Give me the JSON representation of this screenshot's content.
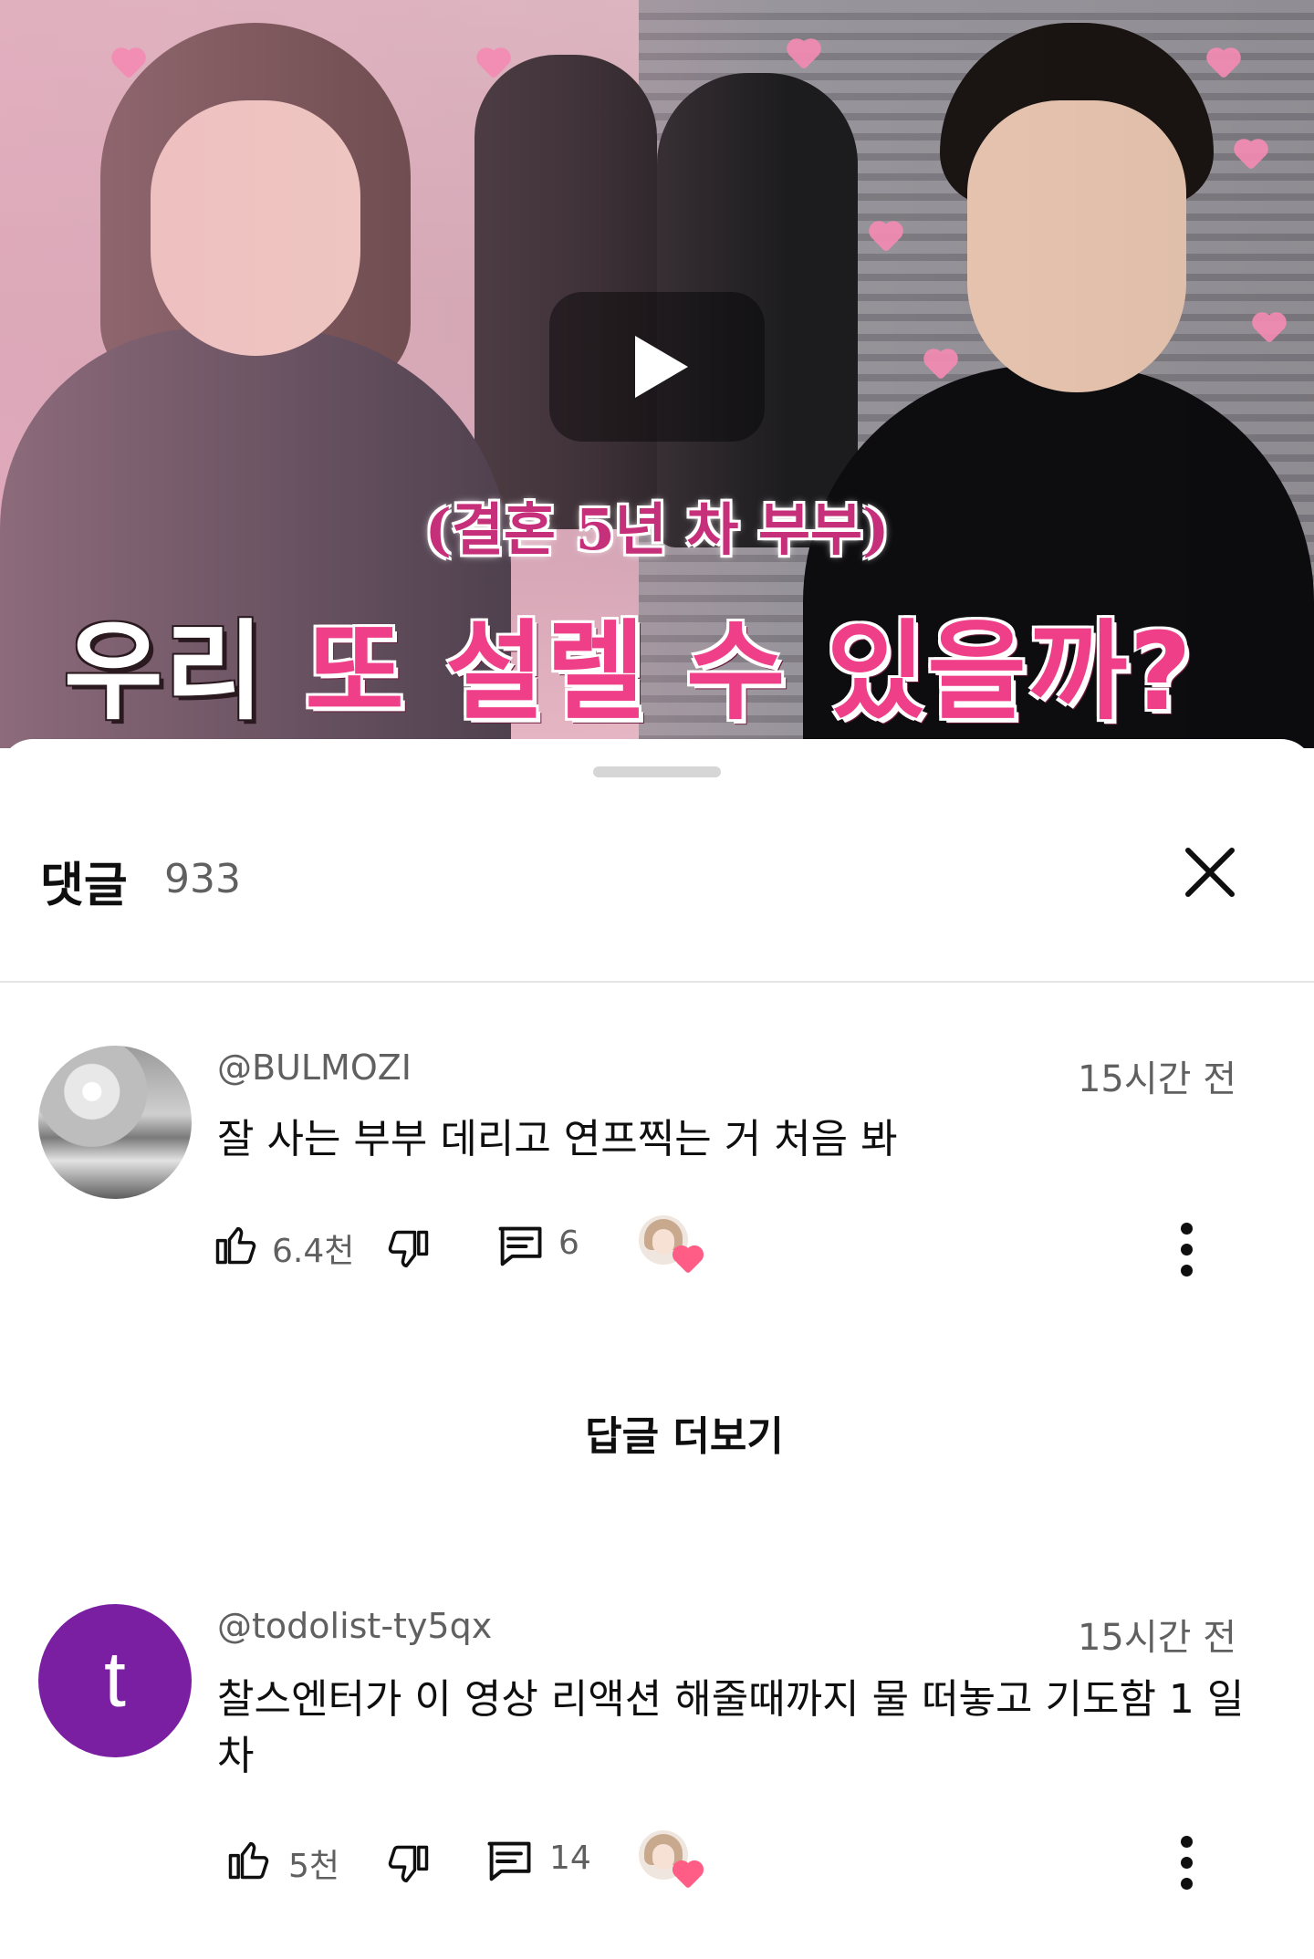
{
  "video": {
    "subtitle": "(결혼 5년 차 부부)",
    "title_white": "우리",
    "title_pink": "또 설렐 수 있을까?",
    "play_icon": "play-icon"
  },
  "comments_panel": {
    "title": "댓글",
    "count": "933",
    "close_icon": "close-icon"
  },
  "comments": [
    {
      "handle": "@BULMOZI",
      "time": "15시간 전",
      "text": "잘 사는 부부 데리고 연프찍는 거 처음 봐",
      "likes": "6.4천",
      "replies": "6"
    },
    {
      "handle": "@todolist-ty5qx",
      "avatar_letter": "t",
      "time": "15시간 전",
      "text": "찰스엔터가 이 영상 리액션 해줄때까지 물 떠놓고 기도함 1 일차",
      "likes": "5천",
      "replies": "14"
    }
  ],
  "view_replies": "답글 더보기",
  "colors": {
    "pink_accent": "#ef3f89",
    "avatar_purple": "#7b1fa2",
    "secondary_text": "#606060"
  }
}
